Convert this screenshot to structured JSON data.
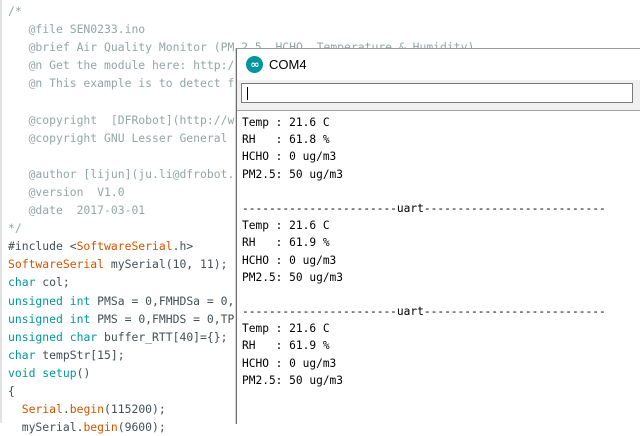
{
  "editor": {
    "lines": [
      [
        {
          "t": "/*",
          "c": "comment"
        }
      ],
      [
        {
          "t": "   @file SEN0233.ino",
          "c": "comment"
        }
      ],
      [
        {
          "t": "   @brief Air Quality Monitor (PM 2.5, HCHO, Temperature & Humidity)",
          "c": "comment"
        }
      ],
      [
        {
          "t": "   @n Get the module here: http://",
          "c": "comment"
        }
      ],
      [
        {
          "t": "   @n This example is to detect f",
          "c": "comment"
        }
      ],
      [
        {
          "t": "",
          "c": "plain"
        }
      ],
      [
        {
          "t": "   @copyright  [DFRobot](http://w",
          "c": "comment"
        }
      ],
      [
        {
          "t": "   @copyright GNU Lesser General",
          "c": "comment"
        }
      ],
      [
        {
          "t": "",
          "c": "plain"
        }
      ],
      [
        {
          "t": "   @author [lijun](ju.li@dfrobot.",
          "c": "comment"
        }
      ],
      [
        {
          "t": "   @version  V1.0",
          "c": "comment"
        }
      ],
      [
        {
          "t": "   @date  2017-03-01",
          "c": "comment"
        }
      ],
      [
        {
          "t": "*/",
          "c": "comment"
        }
      ],
      [
        {
          "t": "#include <",
          "c": "plain"
        },
        {
          "t": "SoftwareSerial",
          "c": "cls"
        },
        {
          "t": ".h>",
          "c": "plain"
        }
      ],
      [
        {
          "t": "SoftwareSerial",
          "c": "cls"
        },
        {
          "t": " mySerial(10, 11);",
          "c": "plain"
        }
      ],
      [
        {
          "t": "char",
          "c": "kw"
        },
        {
          "t": " col;",
          "c": "plain"
        }
      ],
      [
        {
          "t": "unsigned",
          "c": "kw"
        },
        {
          "t": " ",
          "c": "plain"
        },
        {
          "t": "int",
          "c": "kw"
        },
        {
          "t": " PMSa = 0,FMHDSa = 0,",
          "c": "plain"
        }
      ],
      [
        {
          "t": "unsigned",
          "c": "kw"
        },
        {
          "t": " ",
          "c": "plain"
        },
        {
          "t": "int",
          "c": "kw"
        },
        {
          "t": " PMS = 0,FMHDS = 0,TP",
          "c": "plain"
        }
      ],
      [
        {
          "t": "unsigned",
          "c": "kw"
        },
        {
          "t": " ",
          "c": "plain"
        },
        {
          "t": "char",
          "c": "kw"
        },
        {
          "t": " buffer_RTT[40]={};",
          "c": "plain"
        }
      ],
      [
        {
          "t": "char",
          "c": "kw"
        },
        {
          "t": " tempStr[15];",
          "c": "plain"
        }
      ],
      [
        {
          "t": "void",
          "c": "kw"
        },
        {
          "t": " ",
          "c": "plain"
        },
        {
          "t": "setup",
          "c": "kw"
        },
        {
          "t": "()",
          "c": "plain"
        }
      ],
      [
        {
          "t": "{",
          "c": "plain"
        }
      ],
      [
        {
          "t": "  ",
          "c": "plain"
        },
        {
          "t": "Serial",
          "c": "cls"
        },
        {
          "t": ".",
          "c": "plain"
        },
        {
          "t": "begin",
          "c": "cls"
        },
        {
          "t": "(115200);",
          "c": "plain"
        }
      ],
      [
        {
          "t": "  mySerial.",
          "c": "plain"
        },
        {
          "t": "begin",
          "c": "cls"
        },
        {
          "t": "(9600);",
          "c": "plain"
        }
      ]
    ]
  },
  "serial_monitor": {
    "title": "COM4",
    "icon": "arduino-icon",
    "input_value": "",
    "output_lines": [
      "Temp : 21.6 C",
      "RH   : 61.8 %",
      "HCHO : 0 ug/m3",
      "PM2.5: 50 ug/m3",
      "",
      "-----------------------uart---------------------------",
      "Temp : 21.6 C",
      "RH   : 61.9 %",
      "HCHO : 0 ug/m3",
      "PM2.5: 50 ug/m3",
      "",
      "-----------------------uart---------------------------",
      "Temp : 21.6 C",
      "RH   : 61.9 %",
      "HCHO : 0 ug/m3",
      "PM2.5: 50 ug/m3"
    ]
  },
  "colors": {
    "comment": "#95a5a6",
    "keyword": "#00979c",
    "class": "#d35400",
    "plain": "#434f54"
  }
}
